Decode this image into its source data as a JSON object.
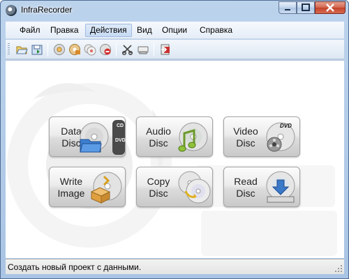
{
  "window": {
    "title": "InfraRecorder"
  },
  "menu": {
    "items": [
      {
        "label": "Файл"
      },
      {
        "label": "Правка"
      },
      {
        "label": "Действия"
      },
      {
        "label": "Вид"
      },
      {
        "label": "Опции"
      },
      {
        "label": "Справка"
      }
    ],
    "active_item": "Действия"
  },
  "toolbar": {
    "buttons": [
      {
        "icon": "open-folder-icon"
      },
      {
        "icon": "save-icon"
      },
      {
        "icon": "burn-image-icon"
      },
      {
        "icon": "burn-compilation-icon"
      },
      {
        "icon": "copy-disc-icon"
      },
      {
        "icon": "erase-disc-icon"
      },
      {
        "icon": "tracks-icon"
      },
      {
        "icon": "disc-info-icon"
      },
      {
        "icon": "exit-icon"
      }
    ]
  },
  "main": {
    "buttons": [
      {
        "label": "Data\nDisc",
        "icon": "data-disc-icon",
        "side_tab": [
          "CD",
          "DVD"
        ]
      },
      {
        "label": "Audio\nDisc",
        "icon": "audio-disc-icon"
      },
      {
        "label": "Video\nDisc",
        "icon": "video-disc-icon",
        "badge": "DVD"
      },
      {
        "label": "Write\nImage",
        "icon": "write-image-icon"
      },
      {
        "label": "Copy\nDisc",
        "icon": "copy-disc-icon"
      },
      {
        "label": "Read\nDisc",
        "icon": "read-disc-icon"
      }
    ]
  },
  "statusbar": {
    "text": "Создать новый проект с данными."
  },
  "colors": {
    "accent_blue": "#c7dbf3",
    "frame": "#a9c4e4",
    "close_red": "#c2432b"
  }
}
